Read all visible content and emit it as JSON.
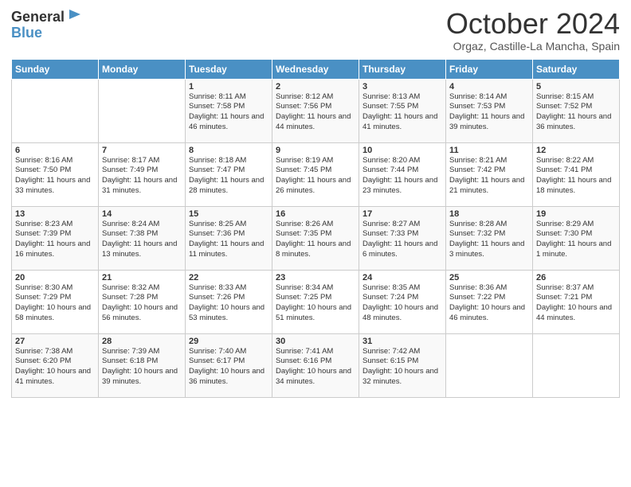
{
  "header": {
    "logo_general": "General",
    "logo_blue": "Blue",
    "title": "October 2024",
    "subtitle": "Orgaz, Castille-La Mancha, Spain"
  },
  "days_of_week": [
    "Sunday",
    "Monday",
    "Tuesday",
    "Wednesday",
    "Thursday",
    "Friday",
    "Saturday"
  ],
  "weeks": [
    [
      {
        "day": "",
        "sunrise": "",
        "sunset": "",
        "daylight": ""
      },
      {
        "day": "",
        "sunrise": "",
        "sunset": "",
        "daylight": ""
      },
      {
        "day": "1",
        "sunrise": "Sunrise: 8:11 AM",
        "sunset": "Sunset: 7:58 PM",
        "daylight": "Daylight: 11 hours and 46 minutes."
      },
      {
        "day": "2",
        "sunrise": "Sunrise: 8:12 AM",
        "sunset": "Sunset: 7:56 PM",
        "daylight": "Daylight: 11 hours and 44 minutes."
      },
      {
        "day": "3",
        "sunrise": "Sunrise: 8:13 AM",
        "sunset": "Sunset: 7:55 PM",
        "daylight": "Daylight: 11 hours and 41 minutes."
      },
      {
        "day": "4",
        "sunrise": "Sunrise: 8:14 AM",
        "sunset": "Sunset: 7:53 PM",
        "daylight": "Daylight: 11 hours and 39 minutes."
      },
      {
        "day": "5",
        "sunrise": "Sunrise: 8:15 AM",
        "sunset": "Sunset: 7:52 PM",
        "daylight": "Daylight: 11 hours and 36 minutes."
      }
    ],
    [
      {
        "day": "6",
        "sunrise": "Sunrise: 8:16 AM",
        "sunset": "Sunset: 7:50 PM",
        "daylight": "Daylight: 11 hours and 33 minutes."
      },
      {
        "day": "7",
        "sunrise": "Sunrise: 8:17 AM",
        "sunset": "Sunset: 7:49 PM",
        "daylight": "Daylight: 11 hours and 31 minutes."
      },
      {
        "day": "8",
        "sunrise": "Sunrise: 8:18 AM",
        "sunset": "Sunset: 7:47 PM",
        "daylight": "Daylight: 11 hours and 28 minutes."
      },
      {
        "day": "9",
        "sunrise": "Sunrise: 8:19 AM",
        "sunset": "Sunset: 7:45 PM",
        "daylight": "Daylight: 11 hours and 26 minutes."
      },
      {
        "day": "10",
        "sunrise": "Sunrise: 8:20 AM",
        "sunset": "Sunset: 7:44 PM",
        "daylight": "Daylight: 11 hours and 23 minutes."
      },
      {
        "day": "11",
        "sunrise": "Sunrise: 8:21 AM",
        "sunset": "Sunset: 7:42 PM",
        "daylight": "Daylight: 11 hours and 21 minutes."
      },
      {
        "day": "12",
        "sunrise": "Sunrise: 8:22 AM",
        "sunset": "Sunset: 7:41 PM",
        "daylight": "Daylight: 11 hours and 18 minutes."
      }
    ],
    [
      {
        "day": "13",
        "sunrise": "Sunrise: 8:23 AM",
        "sunset": "Sunset: 7:39 PM",
        "daylight": "Daylight: 11 hours and 16 minutes."
      },
      {
        "day": "14",
        "sunrise": "Sunrise: 8:24 AM",
        "sunset": "Sunset: 7:38 PM",
        "daylight": "Daylight: 11 hours and 13 minutes."
      },
      {
        "day": "15",
        "sunrise": "Sunrise: 8:25 AM",
        "sunset": "Sunset: 7:36 PM",
        "daylight": "Daylight: 11 hours and 11 minutes."
      },
      {
        "day": "16",
        "sunrise": "Sunrise: 8:26 AM",
        "sunset": "Sunset: 7:35 PM",
        "daylight": "Daylight: 11 hours and 8 minutes."
      },
      {
        "day": "17",
        "sunrise": "Sunrise: 8:27 AM",
        "sunset": "Sunset: 7:33 PM",
        "daylight": "Daylight: 11 hours and 6 minutes."
      },
      {
        "day": "18",
        "sunrise": "Sunrise: 8:28 AM",
        "sunset": "Sunset: 7:32 PM",
        "daylight": "Daylight: 11 hours and 3 minutes."
      },
      {
        "day": "19",
        "sunrise": "Sunrise: 8:29 AM",
        "sunset": "Sunset: 7:30 PM",
        "daylight": "Daylight: 11 hours and 1 minute."
      }
    ],
    [
      {
        "day": "20",
        "sunrise": "Sunrise: 8:30 AM",
        "sunset": "Sunset: 7:29 PM",
        "daylight": "Daylight: 10 hours and 58 minutes."
      },
      {
        "day": "21",
        "sunrise": "Sunrise: 8:32 AM",
        "sunset": "Sunset: 7:28 PM",
        "daylight": "Daylight: 10 hours and 56 minutes."
      },
      {
        "day": "22",
        "sunrise": "Sunrise: 8:33 AM",
        "sunset": "Sunset: 7:26 PM",
        "daylight": "Daylight: 10 hours and 53 minutes."
      },
      {
        "day": "23",
        "sunrise": "Sunrise: 8:34 AM",
        "sunset": "Sunset: 7:25 PM",
        "daylight": "Daylight: 10 hours and 51 minutes."
      },
      {
        "day": "24",
        "sunrise": "Sunrise: 8:35 AM",
        "sunset": "Sunset: 7:24 PM",
        "daylight": "Daylight: 10 hours and 48 minutes."
      },
      {
        "day": "25",
        "sunrise": "Sunrise: 8:36 AM",
        "sunset": "Sunset: 7:22 PM",
        "daylight": "Daylight: 10 hours and 46 minutes."
      },
      {
        "day": "26",
        "sunrise": "Sunrise: 8:37 AM",
        "sunset": "Sunset: 7:21 PM",
        "daylight": "Daylight: 10 hours and 44 minutes."
      }
    ],
    [
      {
        "day": "27",
        "sunrise": "Sunrise: 7:38 AM",
        "sunset": "Sunset: 6:20 PM",
        "daylight": "Daylight: 10 hours and 41 minutes."
      },
      {
        "day": "28",
        "sunrise": "Sunrise: 7:39 AM",
        "sunset": "Sunset: 6:18 PM",
        "daylight": "Daylight: 10 hours and 39 minutes."
      },
      {
        "day": "29",
        "sunrise": "Sunrise: 7:40 AM",
        "sunset": "Sunset: 6:17 PM",
        "daylight": "Daylight: 10 hours and 36 minutes."
      },
      {
        "day": "30",
        "sunrise": "Sunrise: 7:41 AM",
        "sunset": "Sunset: 6:16 PM",
        "daylight": "Daylight: 10 hours and 34 minutes."
      },
      {
        "day": "31",
        "sunrise": "Sunrise: 7:42 AM",
        "sunset": "Sunset: 6:15 PM",
        "daylight": "Daylight: 10 hours and 32 minutes."
      },
      {
        "day": "",
        "sunrise": "",
        "sunset": "",
        "daylight": ""
      },
      {
        "day": "",
        "sunrise": "",
        "sunset": "",
        "daylight": ""
      }
    ]
  ]
}
